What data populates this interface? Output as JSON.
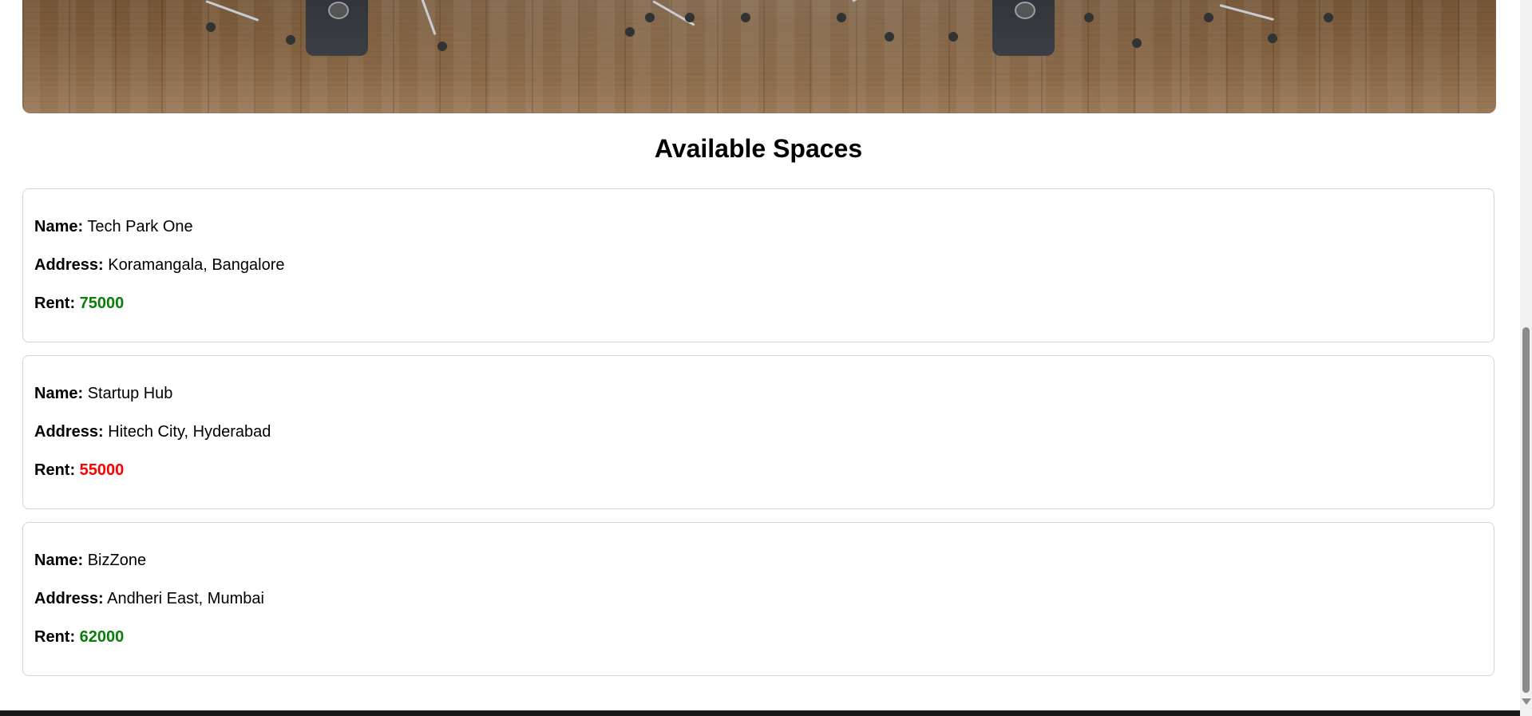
{
  "section_title": "Available Spaces",
  "labels": {
    "name": "Name:",
    "address": "Address:",
    "rent": "Rent:"
  },
  "spaces": [
    {
      "name": "Tech Park One",
      "address": "Koramangala, Bangalore",
      "rent": "75000",
      "rent_color": "#0a7d0a"
    },
    {
      "name": "Startup Hub",
      "address": "Hitech City, Hyderabad",
      "rent": "55000",
      "rent_color": "#ff0000"
    },
    {
      "name": "BizZone",
      "address": "Andheri East, Mumbai",
      "rent": "62000",
      "rent_color": "#0a7d0a"
    }
  ],
  "colors": {
    "rent_ok": "#0a7d0a",
    "rent_high": "#ff0000",
    "card_border": "#d4d4d4"
  }
}
